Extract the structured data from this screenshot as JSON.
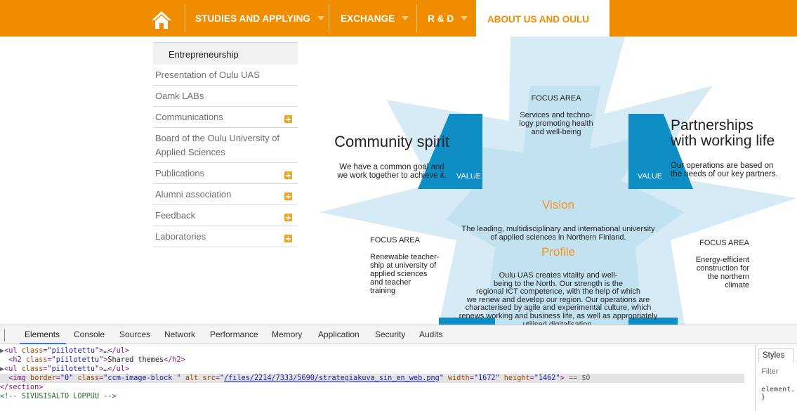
{
  "nav": {
    "items": [
      {
        "label": "STUDIES AND APPLYING"
      },
      {
        "label": "EXCHANGE"
      },
      {
        "label": "R & D"
      }
    ],
    "active": "ABOUT US AND OULU"
  },
  "submenu": {
    "current": "Entrepreneurship",
    "items": [
      {
        "label": "Presentation of Oulu UAS"
      },
      {
        "label": "Oamk LABs"
      },
      {
        "label": "Communications"
      },
      {
        "label": "Board of the Oulu University of Applied Sciences"
      },
      {
        "label": "Publications"
      },
      {
        "label": "Alumni association"
      },
      {
        "label": "Feedback"
      },
      {
        "label": "Laboratories"
      }
    ]
  },
  "graphic": {
    "top_focus": {
      "label": "FOCUS AREA",
      "text": "Services and techno-\nlogy promoting health\nand well-being"
    },
    "community": {
      "title": "Community spirit",
      "text": "We have a common goal and\nwe work together to achieve it."
    },
    "partnerships": {
      "title": "Partnerships\nwith working life",
      "text": "Our operations are based on\nthe needs of our key partners."
    },
    "value_left": "VALUE",
    "value_right": "VALUE",
    "vision": {
      "title": "Vision",
      "text": "The leading, multidisciplinary and international university\nof applied sciences in Northern Finland."
    },
    "left_focus": {
      "label": "FOCUS AREA",
      "text": "Renewable teacher-\nship at university of\napplied sciences\nand teacher\ntraining"
    },
    "right_focus": {
      "label": "FOCUS AREA",
      "text": "Energy-efficient\nconstruction for\nthe northern\nclimate"
    },
    "profile": {
      "title": "Profile",
      "text": "Oulu UAS creates vitality and well-\nbeing to the North. Our strength is the\nregional ICT competence, with the help of which\nwe renew and develop our region. Our operations are\ncharacterised by agile and experimental culture, which\nrenews working and business life, as well as appropriately\nutilised digitalisation."
    },
    "colors": {
      "pale_blue": "#d6ebf6",
      "light_blue": "#c3e2f1",
      "dark_blue": "#0e8ec4",
      "orange": "#f7941d"
    }
  },
  "devtools": {
    "tabs": [
      "Elements",
      "Console",
      "Sources",
      "Network",
      "Performance",
      "Memory",
      "Application",
      "Security",
      "Audits"
    ],
    "dom": {
      "line1_cls": "piilotettu",
      "line1_ellipsis": "…",
      "h2_cls": "piilotettu",
      "h2_text": "Shared themes",
      "line3_cls": "piilotettu",
      "img_border": "0",
      "img_class": "ccm-image-block ",
      "img_src": "/files/2214/7333/5690/strategiakuva_sin_en_web.png",
      "img_width": "1672",
      "img_height": "1462",
      "img_marker": " == $0",
      "close_tag": "</section>",
      "comment": "<!-- SIVUSISALTO LOPPUU -->"
    },
    "styles": {
      "tab": "Styles",
      "filter": "Filter",
      "element": "element.",
      "brace": "}"
    }
  }
}
